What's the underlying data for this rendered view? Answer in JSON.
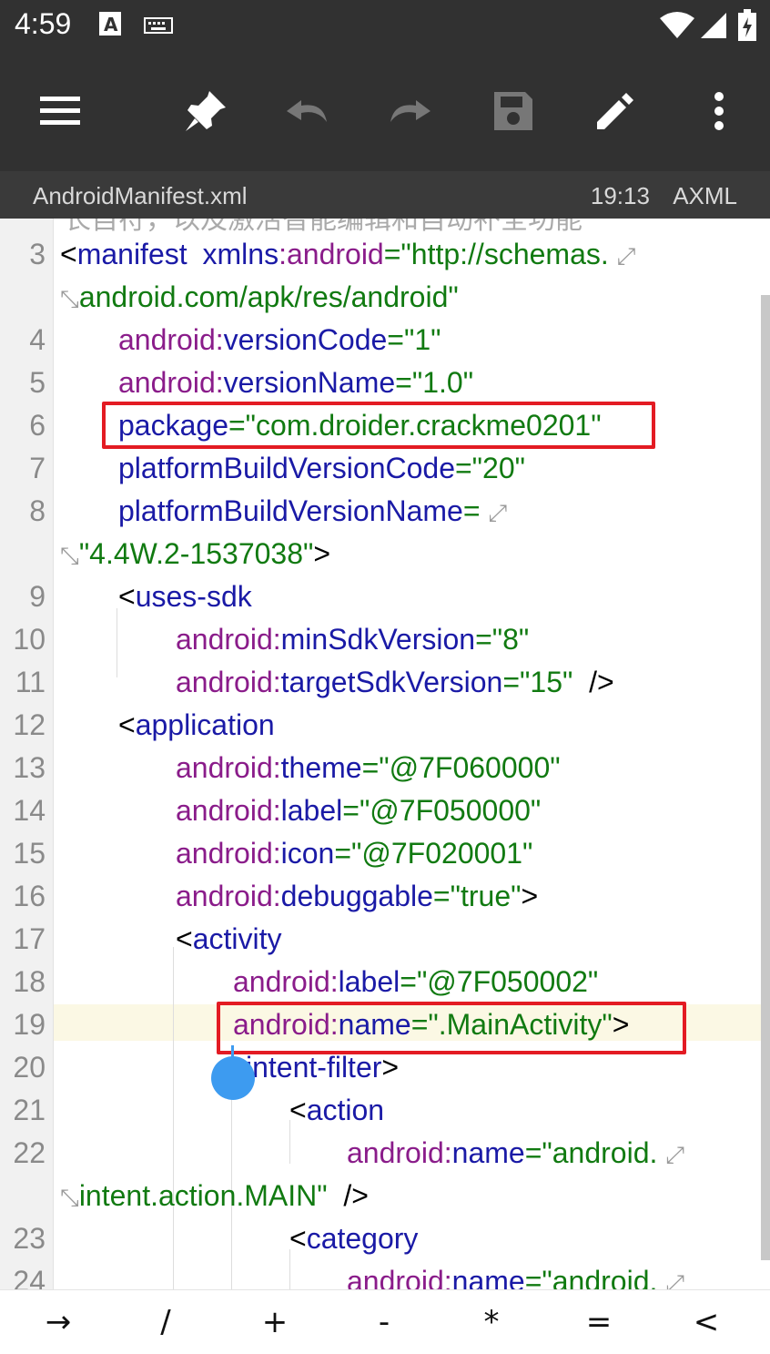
{
  "status_bar": {
    "time": "4:59",
    "icons": [
      "text-a-icon",
      "keyboard-icon",
      "wifi-icon",
      "signal-icon",
      "battery-charging-icon"
    ]
  },
  "toolbar": {
    "buttons": [
      "menu-icon",
      "pin-icon",
      "undo-icon",
      "redo-icon",
      "save-icon",
      "edit-icon",
      "more-vert-icon"
    ]
  },
  "file_bar": {
    "filename": "AndroidManifest.xml",
    "time": "19:13",
    "type": "AXML"
  },
  "editor": {
    "partial_top_text": "长自符，以及激活智能编辑和自动补全功能",
    "lines": [
      {
        "num": "3",
        "p1": "<",
        "tag": "manifest",
        "sp": "  ",
        "a1": "xmlns",
        "colon": ":",
        "a2": "android",
        "eq": "=",
        "val": "\"http://schemas.",
        "end": ""
      },
      {
        "num": "",
        "cont": "android.com/apk/res/android\""
      },
      {
        "num": "4",
        "ns": "android",
        "colon": ":",
        "attr": "versionCode",
        "eq": "=",
        "val": "\"1\""
      },
      {
        "num": "5",
        "ns": "android",
        "colon": ":",
        "attr": "versionName",
        "eq": "=",
        "val": "\"1.0\""
      },
      {
        "num": "6",
        "attr": "package",
        "eq": "=",
        "val": "\"com.droider.crackme0201\""
      },
      {
        "num": "7",
        "attr": "platformBuildVersionCode",
        "eq": "=",
        "val": "\"20\""
      },
      {
        "num": "8",
        "attr": "platformBuildVersionName",
        "eq": "="
      },
      {
        "num": "",
        "cont": "\"4.4W.2-1537038\"",
        "end": ">"
      },
      {
        "num": "9",
        "p1": "<",
        "tag": "uses-sdk"
      },
      {
        "num": "10",
        "ns": "android",
        "colon": ":",
        "attr": "minSdkVersion",
        "eq": "=",
        "val": "\"8\""
      },
      {
        "num": "11",
        "ns": "android",
        "colon": ":",
        "attr": "targetSdkVersion",
        "eq": "=",
        "val": "\"15\"",
        "end": "  />"
      },
      {
        "num": "12",
        "p1": "<",
        "tag": "application"
      },
      {
        "num": "13",
        "ns": "android",
        "colon": ":",
        "attr": "theme",
        "eq": "=",
        "val": "\"@7F060000\""
      },
      {
        "num": "14",
        "ns": "android",
        "colon": ":",
        "attr": "label",
        "eq": "=",
        "val": "\"@7F050000\""
      },
      {
        "num": "15",
        "ns": "android",
        "colon": ":",
        "attr": "icon",
        "eq": "=",
        "val": "\"@7F020001\""
      },
      {
        "num": "16",
        "ns": "android",
        "colon": ":",
        "attr": "debuggable",
        "eq": "=",
        "val": "\"true\"",
        "end": ">"
      },
      {
        "num": "17",
        "p1": "<",
        "tag": "activity"
      },
      {
        "num": "18",
        "ns": "android",
        "colon": ":",
        "attr": "label",
        "eq": "=",
        "val": "\"@7F050002\""
      },
      {
        "num": "19",
        "ns": "android",
        "colon": ":",
        "attr": "name",
        "eq": "=",
        "val": "\".MainActivity\"",
        "end": ">"
      },
      {
        "num": "20",
        "tag": "intent-filter",
        "end": ">"
      },
      {
        "num": "21",
        "p1": "<",
        "tag": "action"
      },
      {
        "num": "22",
        "ns": "android",
        "colon": ":",
        "attr": "name",
        "eq": "=",
        "val": "\"android."
      },
      {
        "num": "",
        "cont": "intent.action.MAIN\"",
        "end": "  />"
      },
      {
        "num": "23",
        "p1": "<",
        "tag": "category"
      },
      {
        "num": "24",
        "ns": "android",
        "colon": ":",
        "attr": "name",
        "eq": "=",
        "val": "\"android."
      }
    ]
  },
  "keys": [
    "→",
    "/",
    "+",
    "-",
    "*",
    "=",
    "<"
  ]
}
